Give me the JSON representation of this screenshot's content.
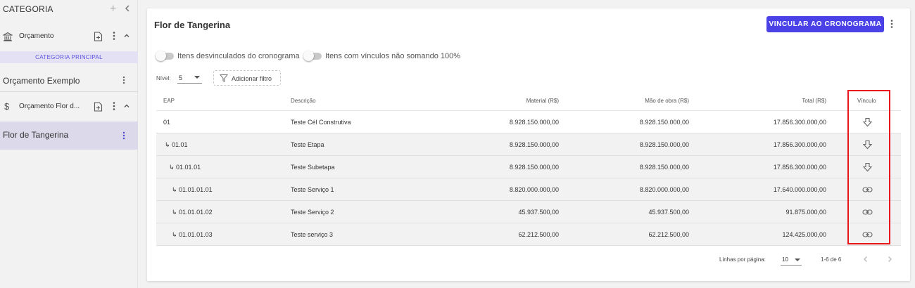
{
  "sidebar": {
    "header": "CATEGORIA",
    "categories": [
      {
        "label": "Orçamento",
        "icon": "bank-icon"
      },
      {
        "label": "Orçamento Flor d...",
        "icon": "dollar-icon"
      }
    ],
    "principal_label": "CATEGORIA PRINCIPAL",
    "items": [
      {
        "label": "Orçamento Exemplo",
        "active": false
      },
      {
        "label": "Flor de Tangerina",
        "active": true
      }
    ]
  },
  "main": {
    "title": "Flor de Tangerina",
    "primary_button": "VINCULAR AO CRONOGRAMA",
    "toggles": [
      {
        "label": "Itens desvinculados do cronograma",
        "on": false
      },
      {
        "label": "Itens com vínculos não somando 100%",
        "on": false
      }
    ],
    "nivel_label": "Nível:",
    "nivel_value": "5",
    "filter_button": "Adicionar filtro",
    "table": {
      "headers": {
        "eap": "EAP",
        "descricao": "Descrição",
        "material": "Material (R$)",
        "mao": "Mão de obra (R$)",
        "total": "Total (R$)",
        "vinculo": "Vínculo"
      },
      "rows": [
        {
          "eap": "01",
          "descricao": "Teste Cél Construtiva",
          "material": "8.928.150.000,00",
          "mao": "8.928.150.000,00",
          "total": "17.856.300.000,00",
          "vinculo_icon": "arrow-down-icon"
        },
        {
          "eap": "↳ 01.01",
          "descricao": "Teste Etapa",
          "material": "8.928.150.000,00",
          "mao": "8.928.150.000,00",
          "total": "17.856.300.000,00",
          "vinculo_icon": "arrow-down-icon"
        },
        {
          "eap": "↳ 01.01.01",
          "descricao": "Teste Subetapa",
          "material": "8.928.150.000,00",
          "mao": "8.928.150.000,00",
          "total": "17.856.300.000,00",
          "vinculo_icon": "arrow-down-icon"
        },
        {
          "eap": "↳ 01.01.01.01",
          "descricao": "Teste Serviço 1",
          "material": "8.820.000.000,00",
          "mao": "8.820.000.000,00",
          "total": "17.640.000.000,00",
          "vinculo_icon": "link-icon"
        },
        {
          "eap": "↳ 01.01.01.02",
          "descricao": "Teste Serviço 2",
          "material": "45.937.500,00",
          "mao": "45.937.500,00",
          "total": "91.875.000,00",
          "vinculo_icon": "link-icon"
        },
        {
          "eap": "↳ 01.01.01.03",
          "descricao": "Teste serviço 3",
          "material": "62.212.500,00",
          "mao": "62.212.500,00",
          "total": "124.425.000,00",
          "vinculo_icon": "link-icon"
        }
      ]
    },
    "pagination": {
      "rows_per_page_label": "Linhas por página:",
      "rows_per_page_value": "10",
      "range": "1-6 de 6"
    }
  },
  "colors": {
    "accent": "#4a42e6",
    "highlight": "#e8161c",
    "active_bg": "#dcdaea"
  }
}
